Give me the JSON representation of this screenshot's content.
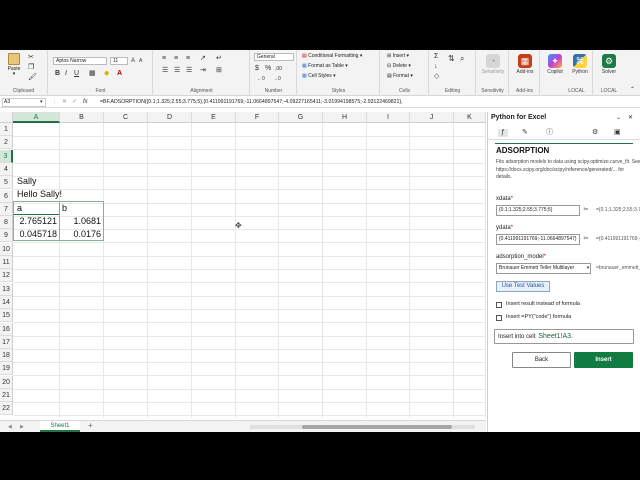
{
  "ribbon": {
    "clipboard": {
      "paste": "Paste",
      "label": "Clipboard"
    },
    "font": {
      "name": "Aptos Narrow",
      "size": "11",
      "label": "Font"
    },
    "alignment": {
      "label": "Alignment"
    },
    "number": {
      "format": "General",
      "label": "Number"
    },
    "styles": {
      "conditional": "Conditional Formatting",
      "table": "Format as Table",
      "cell": "Cell Styles",
      "label": "Styles"
    },
    "cells": {
      "insert": "Insert",
      "delete": "Delete",
      "format": "Format",
      "label": "Cells"
    },
    "editing": {
      "label": "Editing"
    },
    "sensitivity": {
      "btn": "Sensitivity",
      "label": "Sensitivity"
    },
    "addins": {
      "btn": "Add-ins",
      "label": "Add-ins"
    },
    "copilot": {
      "btn": "Copilot"
    },
    "python": {
      "btn": "Python",
      "label": "LOCAL"
    },
    "solver": {
      "btn": "Solver",
      "label": "LOCAL"
    }
  },
  "formula_bar": {
    "name_box": "A3",
    "fx": "fx",
    "formula": "=BF.ADSORPTION({0.1;1.325;2.55;3.775;5},{0.411991191769;-11.0664897547;-4.09227165411;-3.01994198575;-2.93122469821},"
  },
  "grid": {
    "columns": [
      "A",
      "B",
      "C",
      "D",
      "E",
      "F",
      "G",
      "H",
      "I",
      "J",
      "K"
    ],
    "rows": [
      "1",
      "2",
      "3",
      "4",
      "5",
      "6",
      "7",
      "8",
      "9",
      "10",
      "11",
      "12",
      "13",
      "14",
      "15",
      "16",
      "17",
      "18",
      "19",
      "20",
      "21",
      "22"
    ],
    "cells": {
      "a1": "Sally",
      "a2": "Hello Sally!",
      "a3": "a",
      "b3": "b",
      "a4": "2.765121",
      "b4": "1.0681",
      "a5": "0.045718",
      "b5": "0.0176"
    }
  },
  "sheet_tabs": {
    "active": "Sheet1"
  },
  "pane": {
    "title": "Python for Excel",
    "function_name": "ADSORPTION",
    "description": "Fits adsorption models to data using scipy.optimize.curve_fit. See https://docs.scipy.org/doc/scipy/reference/generated/... for details.",
    "xdata_label": "xdata",
    "xdata_value": "{0.1;1.325;2.55;3.775;5}",
    "xdata_result": "={0.1;1.325;2.55;3.775;5}",
    "ydata_label": "ydata",
    "ydata_value": "{0.411991191769;-11.0664897547}",
    "ydata_result": "={0.411991191769;-11.0664897547}",
    "model_label": "adsorption_model",
    "model_value": "Brunauer Emmett Teller Multilayer",
    "model_result": "=brunauer_emmett_teller",
    "use_test_values": "Use Test Values",
    "opt_insert_result": "Insert result instead of formula",
    "opt_insert_py": "Insert =PY(\"code\") formula",
    "insert_into_prefix": "Insert into cell:",
    "insert_into_cell": "Sheet1!A3.",
    "back": "Back",
    "insert": "Insert"
  },
  "colors": {
    "excel_green": "#107c41",
    "selection_green": "#217346",
    "accent_dark": "#1e5f3b"
  }
}
